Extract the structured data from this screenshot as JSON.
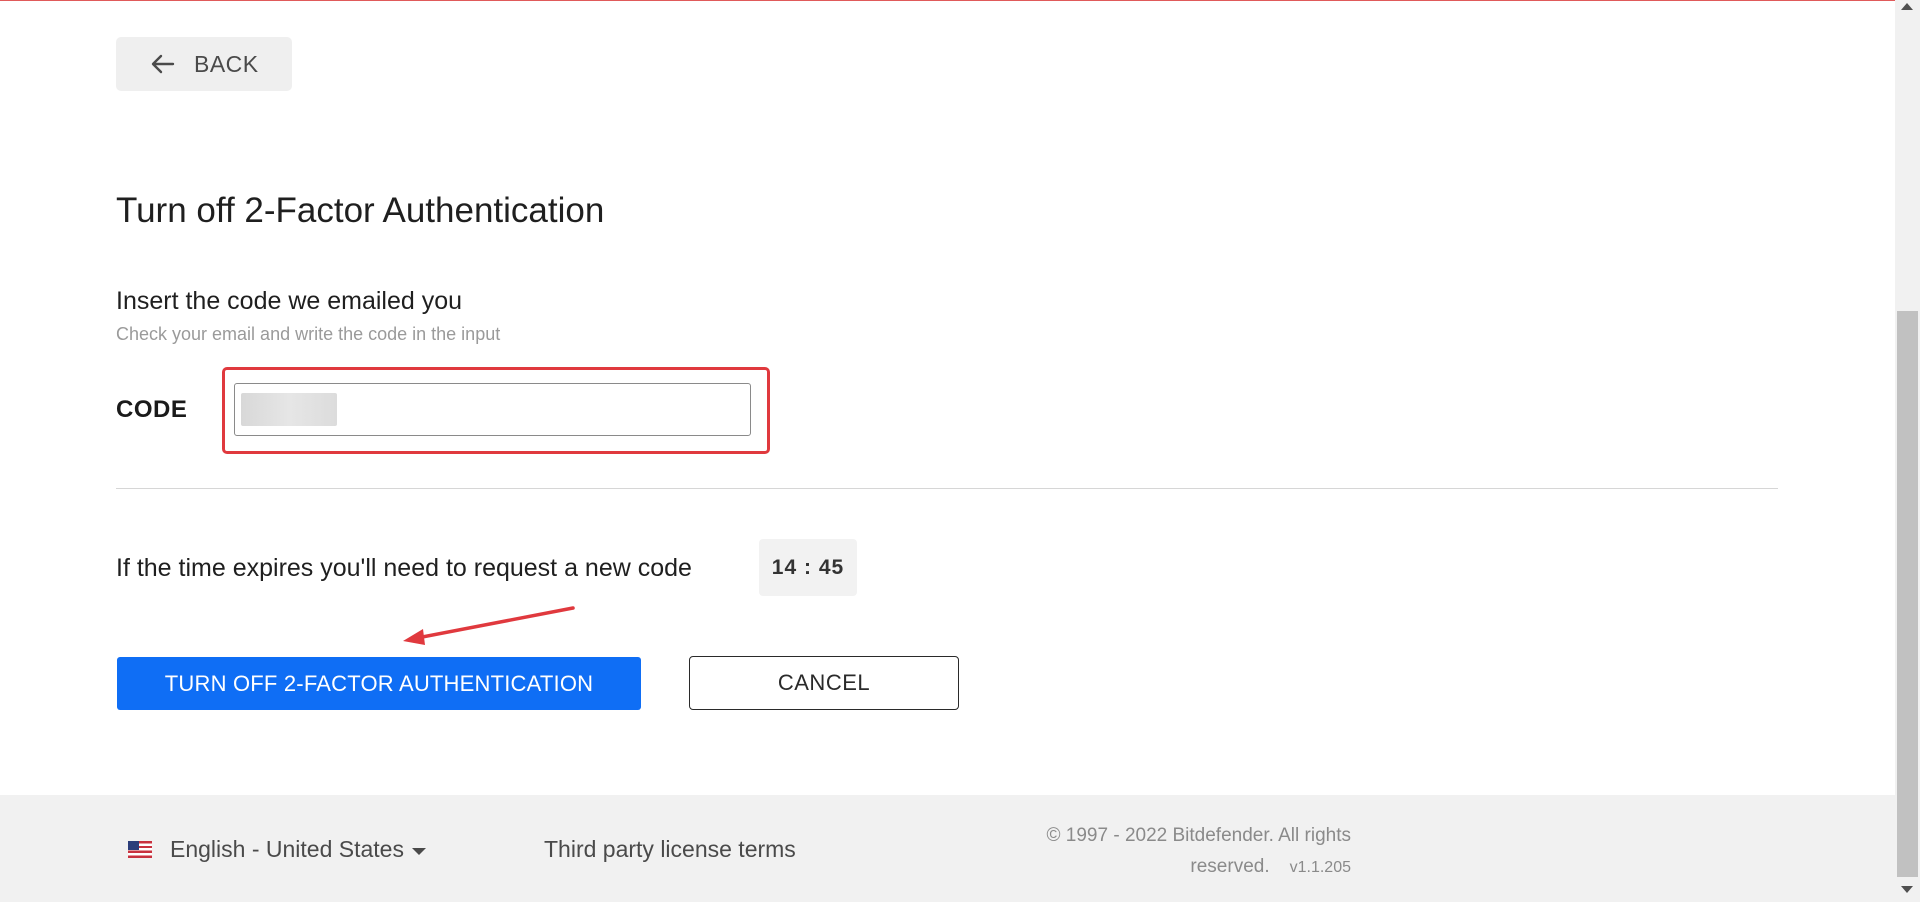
{
  "nav": {
    "back_label": "BACK",
    "back_icon": "arrow-left-icon"
  },
  "page": {
    "title": "Turn off 2-Factor Authentication"
  },
  "code_section": {
    "title": "Insert the code we emailed you",
    "subtitle": "Check your email and write the code in the input",
    "code_label": "CODE",
    "code_value": "",
    "code_placeholder": ""
  },
  "timer": {
    "text": "If the time expires you'll need to request a new code",
    "value": "14 : 45"
  },
  "actions": {
    "primary_label": "TURN OFF 2-FACTOR AUTHENTICATION",
    "cancel_label": "CANCEL"
  },
  "annotations": {
    "highlight_color": "#e0393e",
    "arrow_color": "#e0393e"
  },
  "colors": {
    "primary": "#0f6ef5",
    "footer_bg": "#f1f1f1"
  },
  "footer": {
    "language_icon": "us-flag-icon",
    "language_label": "English - United States",
    "third_party_label": "Third party license terms",
    "copyright_line1": "© 1997 - 2022 Bitdefender. All rights",
    "copyright_line2": "reserved.",
    "version": "v1.1.205"
  }
}
